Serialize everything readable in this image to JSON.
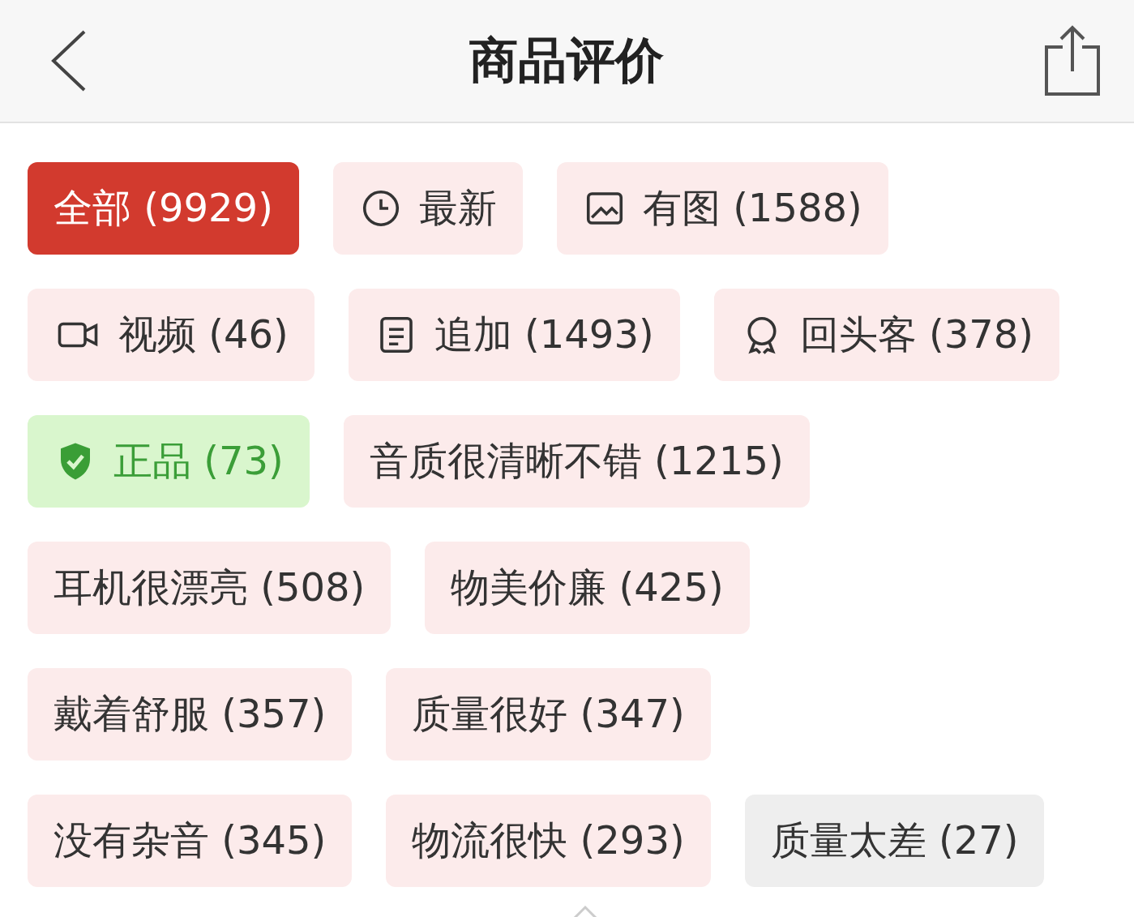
{
  "header": {
    "title": "商品评价"
  },
  "tag_rows": [
    [
      {
        "label": "全部 (9929)",
        "kind": "plain",
        "selected": true
      },
      {
        "label": "最新",
        "kind": "time",
        "selected": false
      },
      {
        "label": "有图 (1588)",
        "kind": "image",
        "selected": false
      }
    ],
    [
      {
        "label": "视频 (46)",
        "kind": "video",
        "selected": false
      },
      {
        "label": "追加 (1493)",
        "kind": "followup",
        "selected": false
      },
      {
        "label": "回头客 (378)",
        "kind": "repeat",
        "selected": false
      }
    ],
    [
      {
        "label": "正品 (73)",
        "kind": "genuine",
        "selected": false
      },
      {
        "label": "音质很清晰不错 (1215)",
        "kind": "plain",
        "selected": false
      }
    ],
    [
      {
        "label": "耳机很漂亮 (508)",
        "kind": "plain",
        "selected": false
      },
      {
        "label": "物美价廉 (425)",
        "kind": "plain",
        "selected": false
      }
    ],
    [
      {
        "label": "戴着舒服 (357)",
        "kind": "plain",
        "selected": false
      },
      {
        "label": "质量很好 (347)",
        "kind": "plain",
        "selected": false
      }
    ],
    [
      {
        "label": "没有杂音 (345)",
        "kind": "plain",
        "selected": false
      },
      {
        "label": "物流很快 (293)",
        "kind": "plain",
        "selected": false
      },
      {
        "label": "质量太差 (27)",
        "kind": "negative",
        "selected": false
      }
    ]
  ]
}
